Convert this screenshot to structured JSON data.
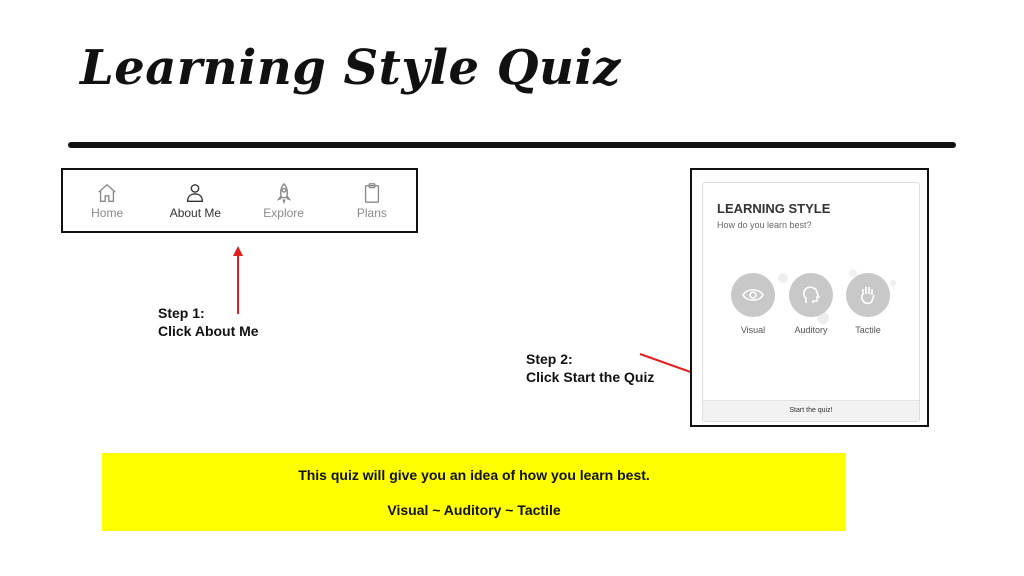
{
  "title": "Learning Style Quiz",
  "nav": {
    "items": [
      {
        "label": "Home",
        "icon": "home-icon"
      },
      {
        "label": "About Me",
        "icon": "person-icon"
      },
      {
        "label": "Explore",
        "icon": "rocket-icon"
      },
      {
        "label": "Plans",
        "icon": "clipboard-icon"
      }
    ],
    "active": "About Me"
  },
  "step1": {
    "line1": "Step 1:",
    "line2": "Click About Me"
  },
  "step2": {
    "line1": "Step 2:",
    "line2": "Click Start the Quiz"
  },
  "quiz": {
    "title": "LEARNING STYLE",
    "subtitle": "How do you learn best?",
    "options": [
      {
        "label": "Visual",
        "icon": "eye-icon"
      },
      {
        "label": "Auditory",
        "icon": "head-icon"
      },
      {
        "label": "Tactile",
        "icon": "hand-icon"
      }
    ],
    "start_label": "Start the quiz!"
  },
  "info": {
    "line1": "This quiz will give you an idea of how you learn best.",
    "line2": "Visual ~ Auditory ~ Tactile"
  },
  "colors": {
    "arrow": "#e02020",
    "highlight": "#ffff00"
  }
}
